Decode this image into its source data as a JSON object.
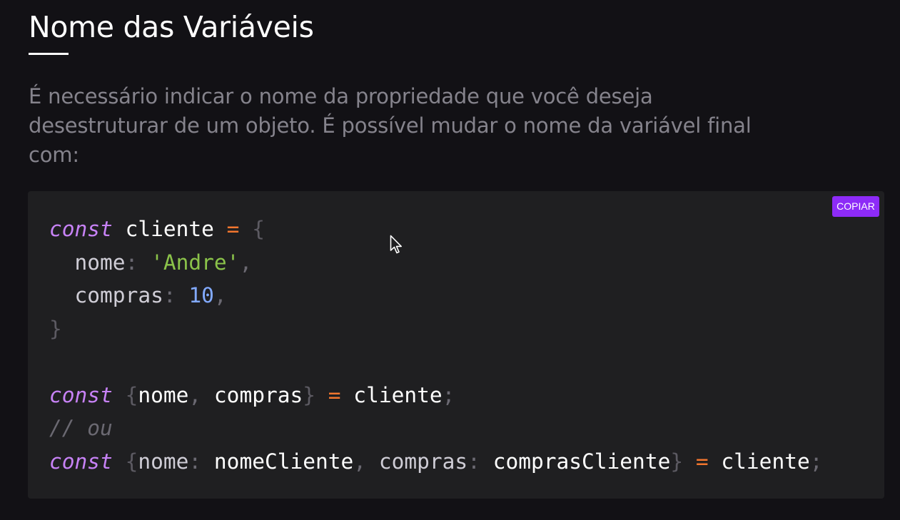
{
  "section": {
    "title": "Nome das Variáveis",
    "description": "É necessário indicar o nome da propriedade que você deseja desestruturar de um objeto. É possível mudar o nome da variável final com:"
  },
  "code_block": {
    "copy_label": "COPIAR",
    "colors": {
      "background": "#1f1f21",
      "keyword": "#c782f6",
      "operator": "#f2762e",
      "string": "#8bc34a",
      "number": "#82aaff",
      "comment": "#6b6972",
      "copy_button": "#8d2bf7"
    },
    "lines": [
      [
        {
          "t": "const",
          "c": "kw"
        },
        {
          "t": " cliente ",
          "c": ""
        },
        {
          "t": "=",
          "c": "op"
        },
        {
          "t": " ",
          "c": ""
        },
        {
          "t": "{",
          "c": "br"
        }
      ],
      [
        {
          "t": "  nome",
          "c": "pr"
        },
        {
          "t": ": ",
          "c": "pn"
        },
        {
          "t": "'Andre'",
          "c": "str"
        },
        {
          "t": ",",
          "c": "pn"
        }
      ],
      [
        {
          "t": "  compras",
          "c": "pr"
        },
        {
          "t": ": ",
          "c": "pn"
        },
        {
          "t": "10",
          "c": "num"
        },
        {
          "t": ",",
          "c": "pn"
        }
      ],
      [
        {
          "t": "}",
          "c": "br"
        }
      ],
      [],
      [
        {
          "t": "const",
          "c": "kw"
        },
        {
          "t": " ",
          "c": ""
        },
        {
          "t": "{",
          "c": "br"
        },
        {
          "t": "nome",
          "c": ""
        },
        {
          "t": ", ",
          "c": "pn"
        },
        {
          "t": "compras",
          "c": ""
        },
        {
          "t": "}",
          "c": "br"
        },
        {
          "t": " ",
          "c": ""
        },
        {
          "t": "=",
          "c": "op"
        },
        {
          "t": " cliente",
          "c": ""
        },
        {
          "t": ";",
          "c": "pn"
        }
      ],
      [
        {
          "t": "// ou",
          "c": "cm"
        }
      ],
      [
        {
          "t": "const",
          "c": "kw"
        },
        {
          "t": " ",
          "c": ""
        },
        {
          "t": "{",
          "c": "br"
        },
        {
          "t": "nome",
          "c": "pr"
        },
        {
          "t": ": ",
          "c": "pn"
        },
        {
          "t": "nomeCliente",
          "c": ""
        },
        {
          "t": ", ",
          "c": "pn"
        },
        {
          "t": "compras",
          "c": "pr"
        },
        {
          "t": ": ",
          "c": "pn"
        },
        {
          "t": "comprasCliente",
          "c": ""
        },
        {
          "t": "}",
          "c": "br"
        },
        {
          "t": " ",
          "c": ""
        },
        {
          "t": "=",
          "c": "op"
        },
        {
          "t": " cliente",
          "c": ""
        },
        {
          "t": ";",
          "c": "pn"
        }
      ]
    ]
  }
}
